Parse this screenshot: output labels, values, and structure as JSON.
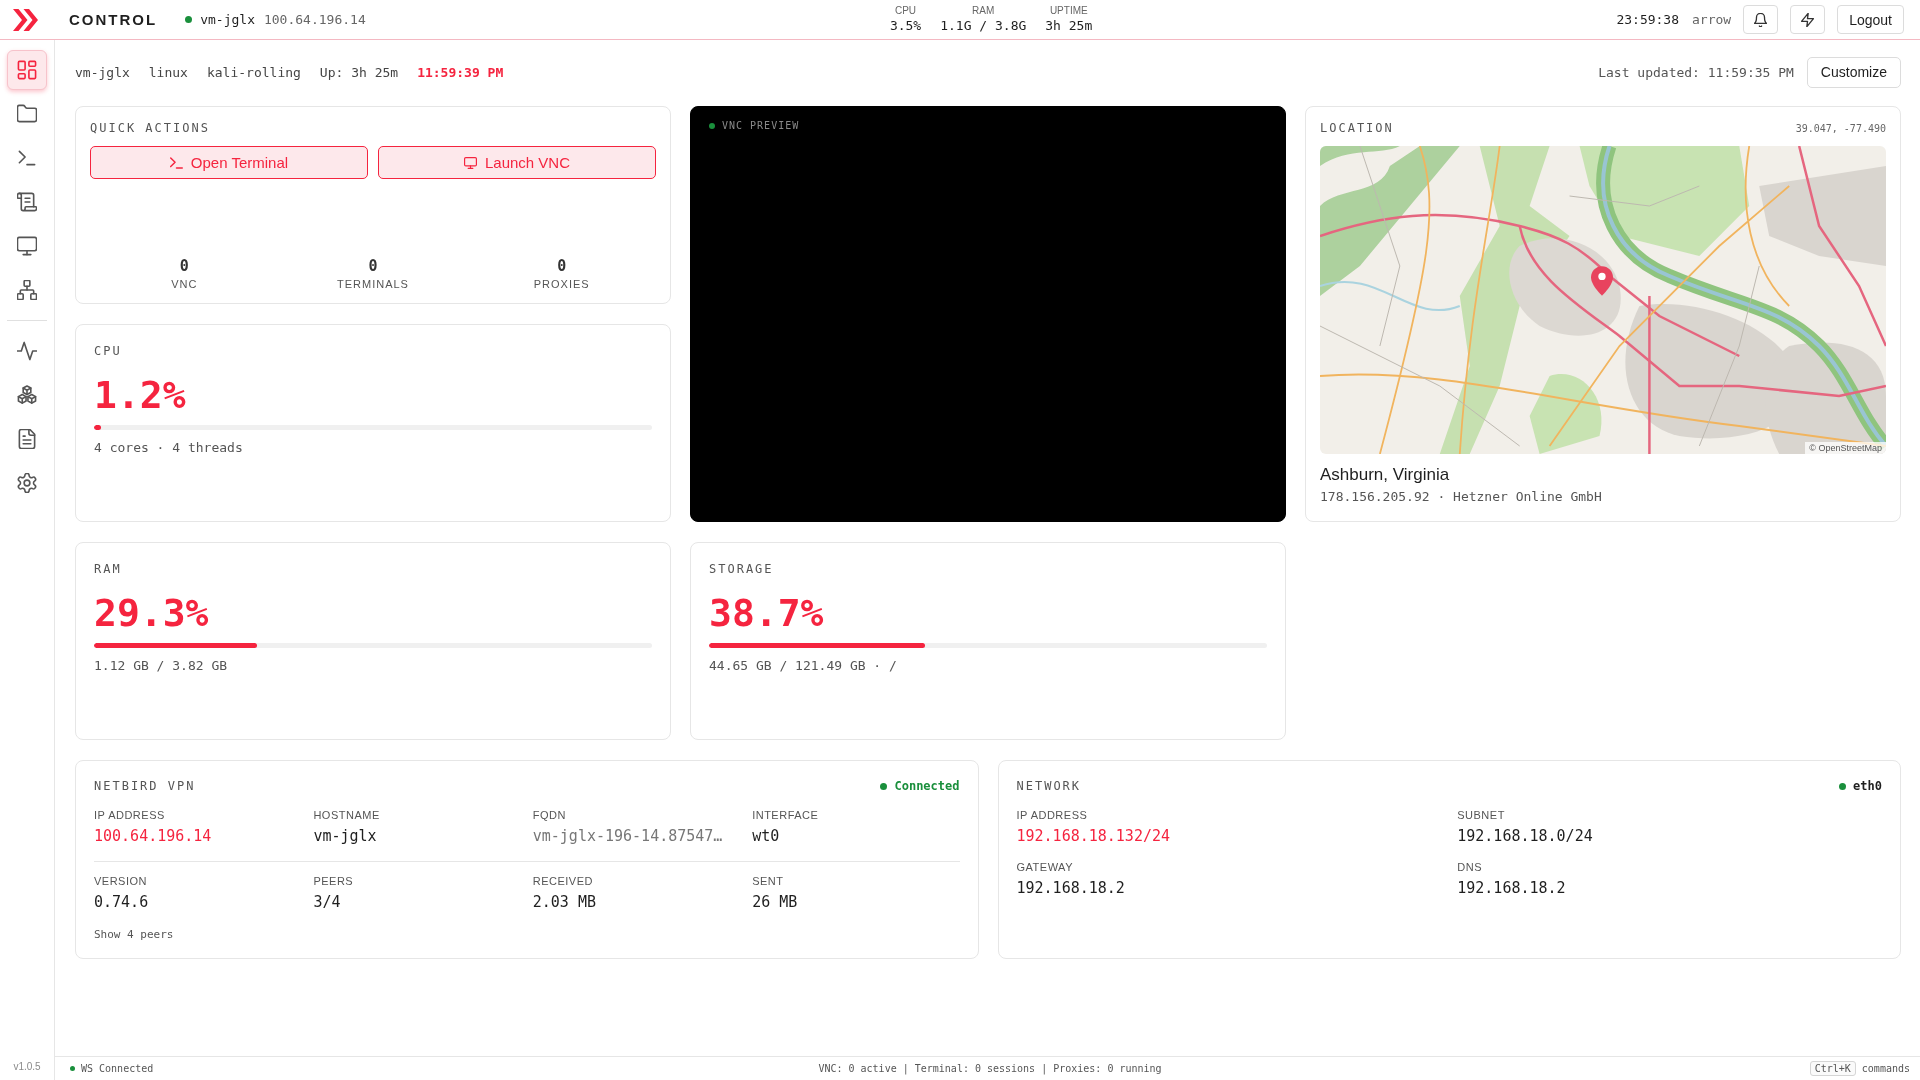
{
  "top_bar": {
    "brand": "CONTROL",
    "host": {
      "online": true,
      "name": "vm-jglx",
      "ip": "100.64.196.14"
    },
    "stats": [
      {
        "label": "CPU",
        "value": "3.5%"
      },
      {
        "label": "RAM",
        "value": "1.1G / 3.8G"
      },
      {
        "label": "UPTIME",
        "value": "3h 25m"
      }
    ],
    "clock": "23:59:38",
    "user": "arrow",
    "logout": "Logout"
  },
  "sidebar": {
    "sections": [
      {
        "items": [
          {
            "kind": "dashboard",
            "selected": true
          },
          {
            "kind": "files",
            "selected": false
          },
          {
            "kind": "terminal",
            "selected": false
          },
          {
            "kind": "scripts",
            "selected": false
          },
          {
            "kind": "display",
            "selected": false
          },
          {
            "kind": "network",
            "selected": false
          }
        ]
      },
      {
        "items": [
          {
            "kind": "activity",
            "selected": false
          },
          {
            "kind": "packages",
            "selected": false
          },
          {
            "kind": "documents",
            "selected": false
          },
          {
            "kind": "settings",
            "selected": false
          }
        ]
      }
    ],
    "version": "v1.0.5"
  },
  "info_bar": {
    "items": [
      "vm-jglx",
      "linux",
      "kali-rolling",
      "Up: 3h 25m"
    ],
    "time": "11:59:39 PM",
    "last_updated": "Last updated: 11:59:35 PM",
    "customize": "Customize"
  },
  "quick_actions": {
    "title": "QUICK ACTIONS",
    "buttons": [
      {
        "kind": "terminal",
        "label": "Open Terminal"
      },
      {
        "kind": "vnc",
        "label": "Launch VNC"
      }
    ],
    "counters": [
      {
        "value": "0",
        "label": "VNC"
      },
      {
        "value": "0",
        "label": "TERMINALS"
      },
      {
        "value": "0",
        "label": "PROXIES"
      }
    ]
  },
  "vnc_preview": {
    "label": "VNC PREVIEW",
    "connected": true
  },
  "location": {
    "title": "LOCATION",
    "coords": "39.047, -77.490",
    "attribution": "© OpenStreetMap",
    "place": "Ashburn, Virginia",
    "detail": "178.156.205.92 · Hetzner Online GmbH"
  },
  "cpu_card": {
    "title": "CPU",
    "value": "1.2%",
    "level": 0.012,
    "detail": "4 cores · 4 threads"
  },
  "ram_card": {
    "title": "RAM",
    "value": "29.3%",
    "level": 0.293,
    "detail": "1.12 GB / 3.82 GB"
  },
  "storage_card": {
    "title": "STORAGE",
    "value": "38.7%",
    "level": 0.387,
    "detail": "44.65 GB / 121.49 GB · /"
  },
  "netbird_vpn": {
    "title": "NETBIRD VPN",
    "status": {
      "label": "Connected",
      "connected": true
    },
    "rows": [
      [
        {
          "label": "IP ADDRESS",
          "value": "100.64.196.14",
          "kind": "accent"
        },
        {
          "label": "HOSTNAME",
          "value": "vm-jglx",
          "kind": "plain"
        },
        {
          "label": "FQDN",
          "value": "vm-jglx-196-14.87547…",
          "kind": "muted"
        },
        {
          "label": "INTERFACE",
          "value": "wt0",
          "kind": "plain"
        }
      ],
      [
        {
          "label": "VERSION",
          "value": "0.74.6",
          "kind": "plain"
        },
        {
          "label": "PEERS",
          "value": "3/4",
          "kind": "plain"
        },
        {
          "label": "RECEIVED",
          "value": "2.03 MB",
          "kind": "plain"
        },
        {
          "label": "SENT",
          "value": "26 MB",
          "kind": "plain"
        }
      ]
    ],
    "peers_link": "Show 4 peers"
  },
  "network": {
    "title": "NETWORK",
    "interface": {
      "label": "eth0",
      "up": true
    },
    "rows": [
      [
        {
          "label": "IP ADDRESS",
          "value": "192.168.18.132/24",
          "kind": "accent"
        },
        {
          "label": "SUBNET",
          "value": "192.168.18.0/24",
          "kind": "plain"
        }
      ],
      [
        {
          "label": "GATEWAY",
          "value": "192.168.18.2",
          "kind": "plain"
        },
        {
          "label": "DNS",
          "value": "192.168.18.2",
          "kind": "plain"
        }
      ]
    ]
  },
  "status_bar": {
    "ws": {
      "label": "WS Connected",
      "connected": true
    },
    "summary": "VNC: 0 active | Terminal: 0 sessions | Proxies: 0 running",
    "shortcut": {
      "key": "Ctrl+K",
      "label": "commands"
    }
  }
}
